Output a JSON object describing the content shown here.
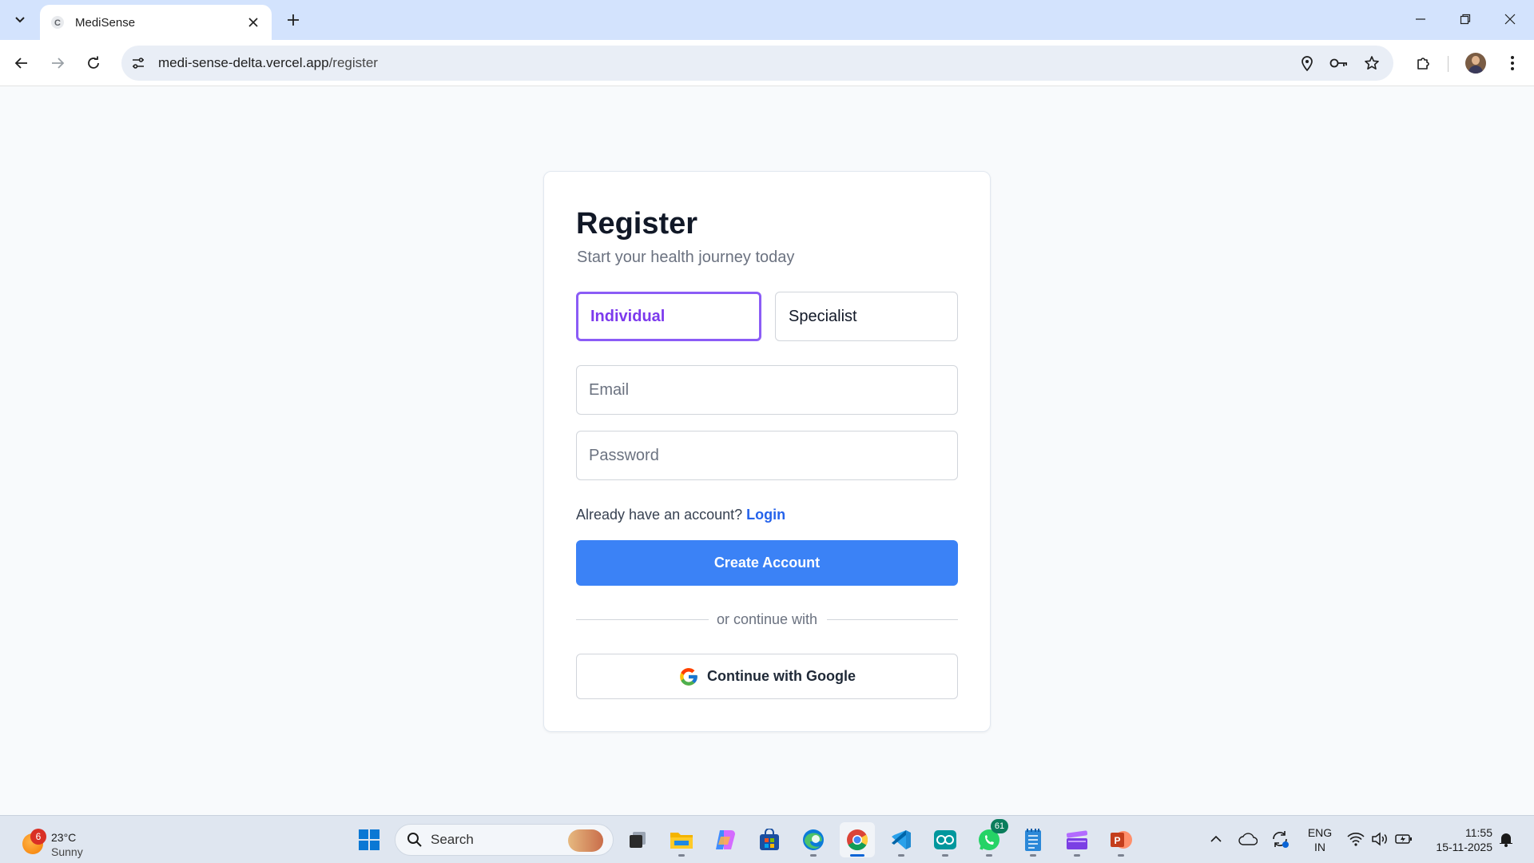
{
  "browser": {
    "tab_title": "MediSense",
    "url_host": "medi-sense-delta.vercel.app",
    "url_path": "/register"
  },
  "register": {
    "title": "Register",
    "subtitle": "Start your health journey today",
    "role_individual": "Individual",
    "role_specialist": "Specialist",
    "selected_role": "Individual",
    "email_placeholder": "Email",
    "password_placeholder": "Password",
    "login_prompt": "Already have an account?",
    "login_link": "Login",
    "create_button": "Create Account",
    "divider_text": "or continue with",
    "google_button": "Continue with Google"
  },
  "colors": {
    "primary": "#3b82f6",
    "selected_role_border": "#8b5cf6",
    "link": "#2563eb"
  },
  "taskbar": {
    "weather_badge": "6",
    "temperature": "23°C",
    "condition": "Sunny",
    "search_label": "Search",
    "whatsapp_badge": "61",
    "lang_primary": "ENG",
    "lang_secondary": "IN",
    "time": "11:55",
    "date": "15-11-2025"
  }
}
